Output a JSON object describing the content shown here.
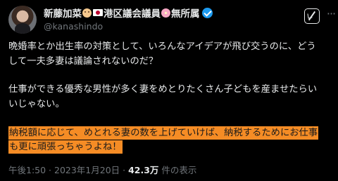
{
  "author": {
    "display_name_prefix": "新藤加菜",
    "display_name_middle": "港区議会議員",
    "display_name_suffix": "無所属",
    "handle": "@kanashindo",
    "emoji_1": "smiling-face",
    "emoji_2": "japan-flag",
    "emoji_3": "cherry-blossom",
    "verified_color": "#1d9bf0"
  },
  "post": {
    "paragraph_1": [
      "晩婚率とか出生率の対策として、いろんなアイデアが飛び交うのに、どう",
      "して一夫多妻は議論されないのだ？"
    ],
    "paragraph_2": [
      "仕事ができる優秀な男性が多く妻をめとりたくさん子どもを産ませたらい",
      "いじゃない。"
    ],
    "highlighted": [
      "納税額に応じて、めとれる妻の数を上げていけば、納税するためにお仕事",
      "も更に頑張っちゃうよね！"
    ],
    "highlight_color": "#f58c25"
  },
  "meta": {
    "timestamp": "午後1:50 · 2023年1月20日 · ",
    "views_count": "42.3万",
    "views_label": " 件の表示"
  },
  "actions": {
    "grok_icon": "grok-icon",
    "more_icon": "more-icon",
    "more_glyph": "···"
  }
}
